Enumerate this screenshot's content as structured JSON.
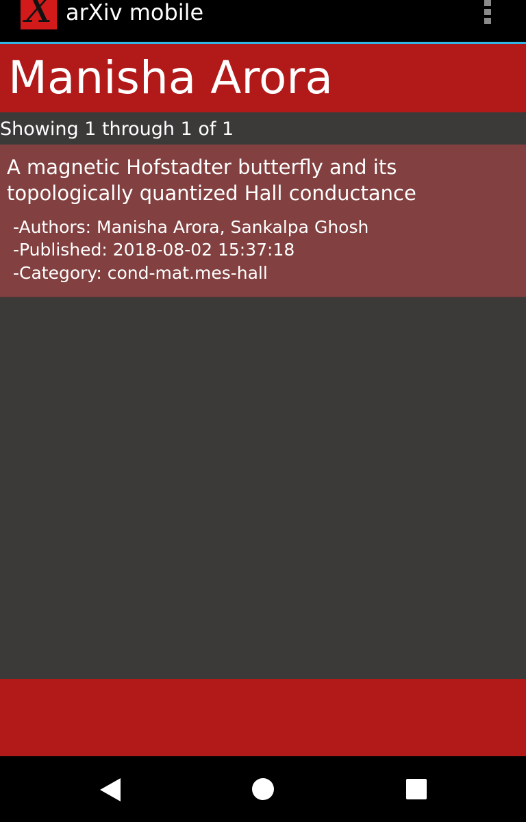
{
  "app_bar": {
    "logo_letter": "X",
    "title": "arXiv mobile",
    "overflow_icon": "overflow-menu-icon"
  },
  "header": {
    "title": "Manisha Arora"
  },
  "results": {
    "count_text": "Showing 1 through 1 of 1",
    "items": [
      {
        "title": "A magnetic Hofstadter butterfly and its topologically quantized Hall conductance",
        "authors": "-Authors: Manisha Arora, Sankalpa Ghosh",
        "published": "-Published: 2018-08-02 15:37:18",
        "category": "-Category: cond-mat.mes-hall"
      }
    ]
  },
  "nav_bar": {
    "back_icon": "back-icon",
    "home_icon": "home-icon",
    "recents_icon": "recents-icon"
  },
  "colors": {
    "action_bar": "#000000",
    "accent_line": "#33b5e5",
    "header_red": "#b21a1a",
    "item_background": "#834040",
    "screen_background": "#3b3a39",
    "text": "#ffffff"
  }
}
